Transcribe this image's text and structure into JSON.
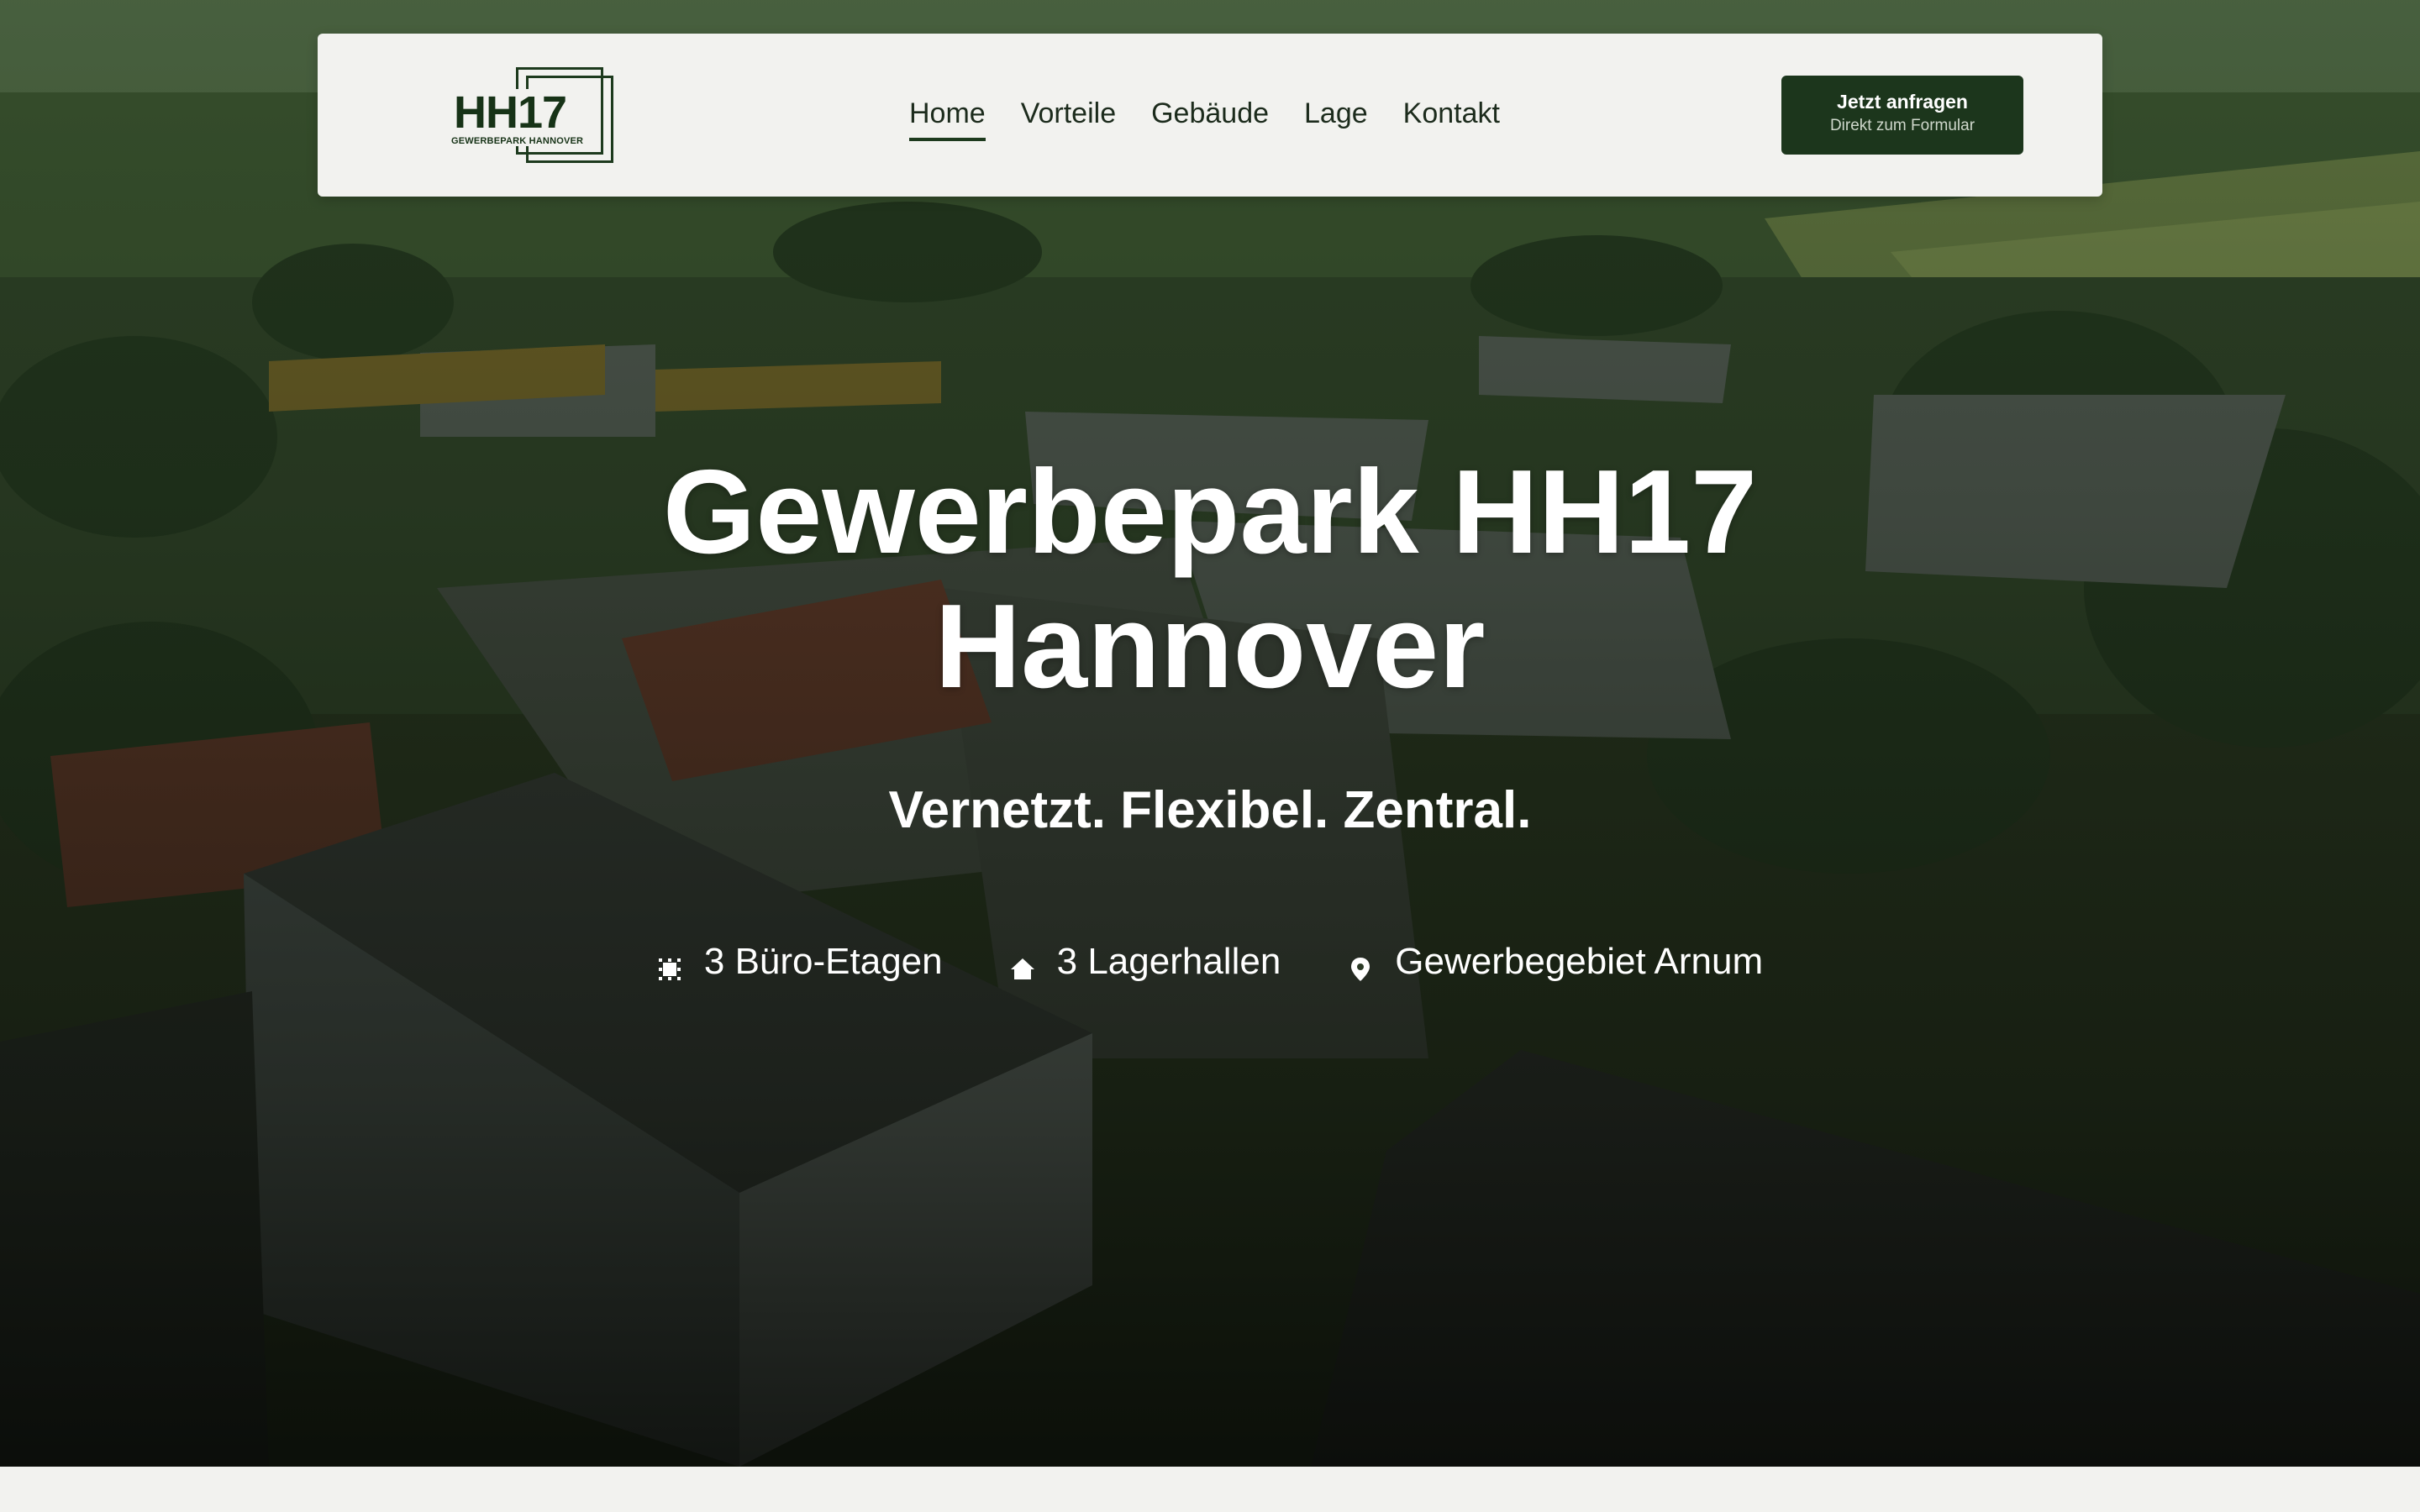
{
  "header": {
    "logo": {
      "mark": "HH17",
      "subtitle": "GEWERBEPARK HANNOVER"
    },
    "nav": [
      {
        "label": "Home",
        "active": true
      },
      {
        "label": "Vorteile",
        "active": false
      },
      {
        "label": "Gebäude",
        "active": false
      },
      {
        "label": "Lage",
        "active": false
      },
      {
        "label": "Kontakt",
        "active": false
      }
    ],
    "cta": {
      "title": "Jetzt anfragen",
      "subtitle": "Direkt zum Formular"
    }
  },
  "hero": {
    "title_line1": "Gewerbepark HH17",
    "title_line2": "Hannover",
    "subtitle": "Vernetzt. Flexibel. Zentral.",
    "features": [
      {
        "icon": "office-floor-icon",
        "label": "3 Büro-Etagen"
      },
      {
        "icon": "home-icon",
        "label": "3 Lagerhallen"
      },
      {
        "icon": "map-pin-icon",
        "label": "Gewerbegebiet Arnum"
      }
    ]
  },
  "colors": {
    "brand_green": "#1c361c",
    "nav_background": "#f2f2ef",
    "hero_text": "#ffffff"
  }
}
